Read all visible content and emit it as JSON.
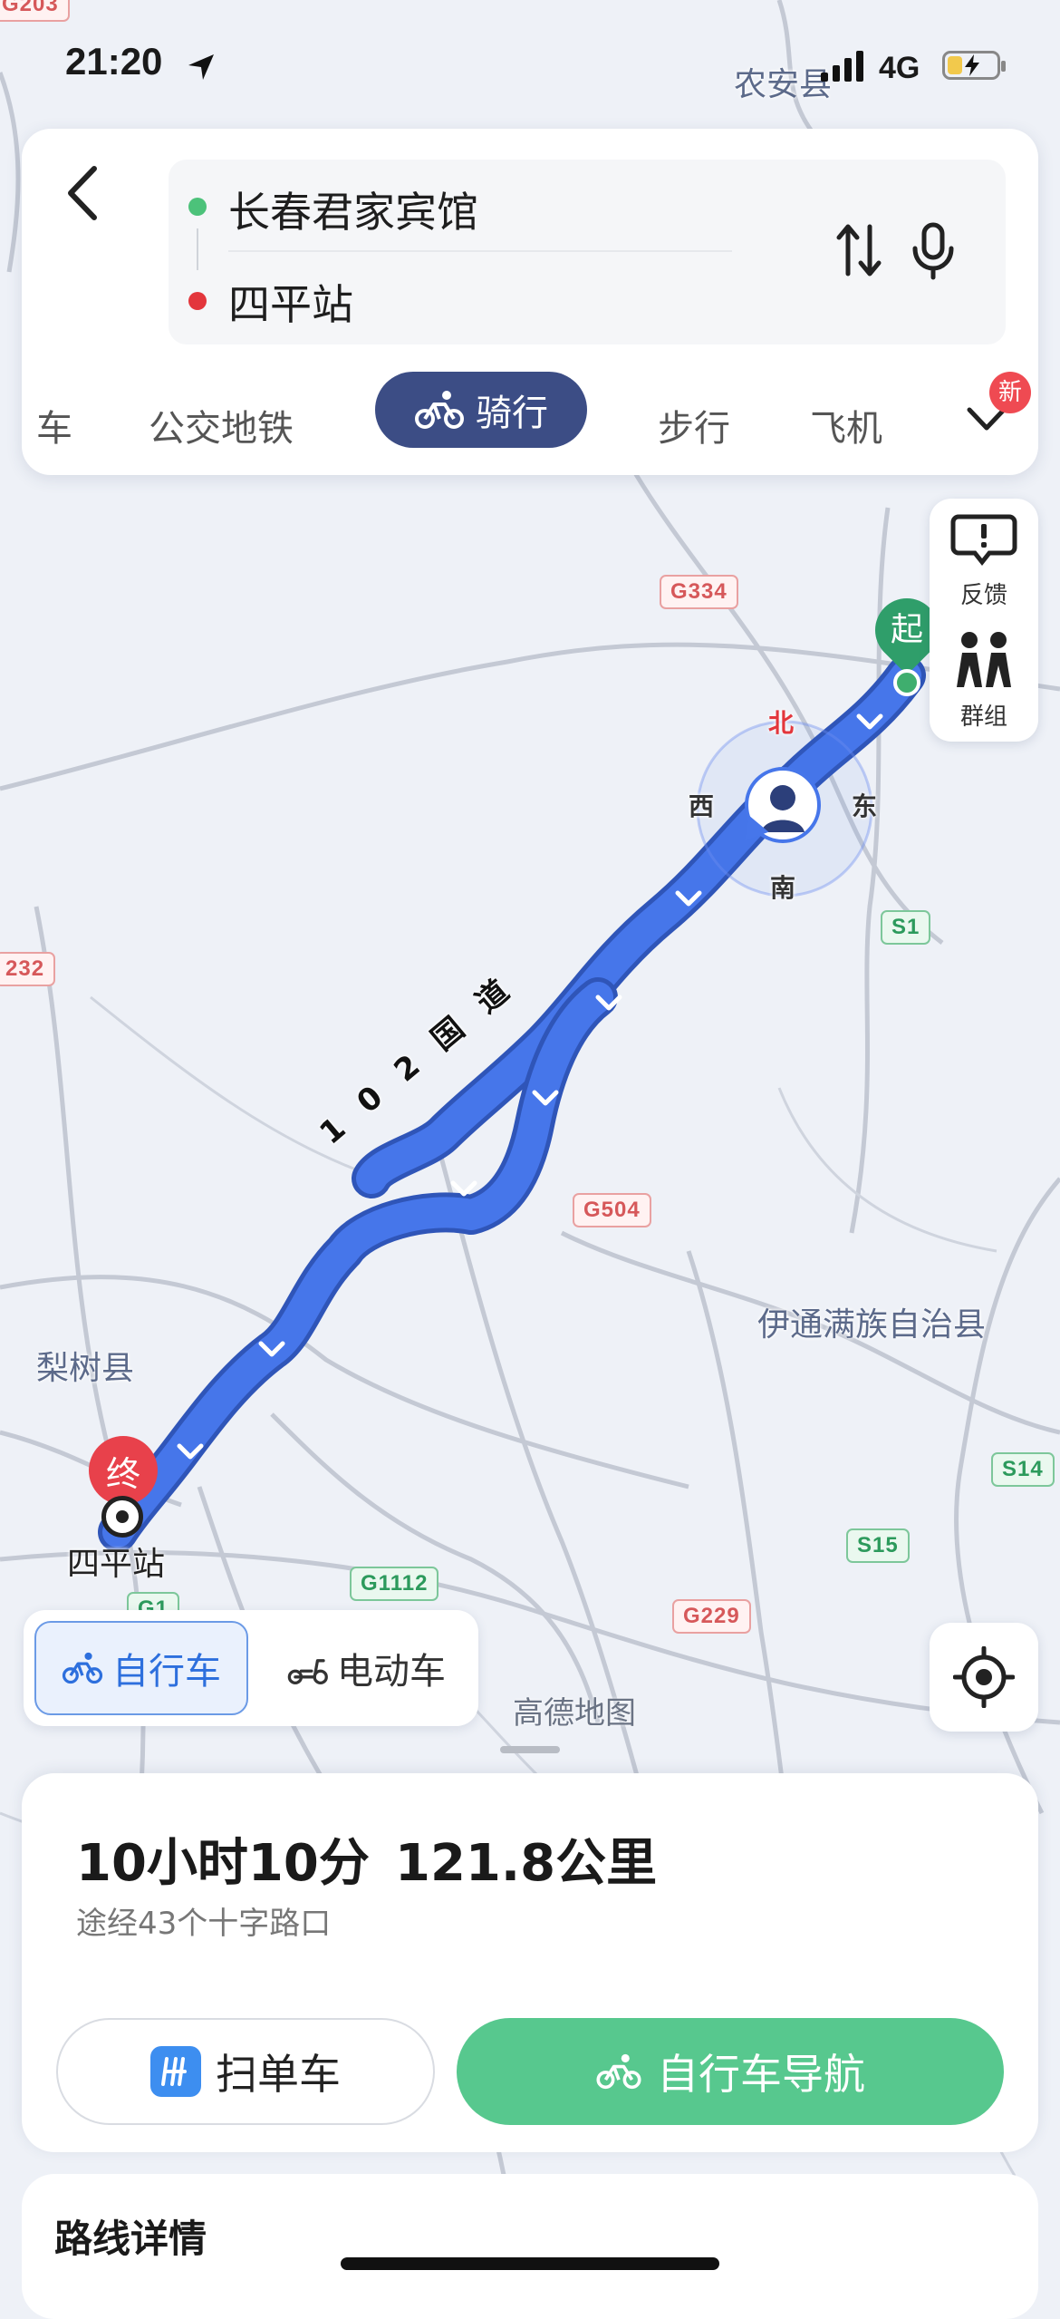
{
  "status_bar": {
    "time": "21:20",
    "network": "4G"
  },
  "search": {
    "origin": "长春君家宾馆",
    "destination": "四平站",
    "modes": [
      "车",
      "公交地铁",
      "骑行",
      "步行",
      "飞机"
    ],
    "active_mode": "骑行",
    "new_badge": "新"
  },
  "side_panel": {
    "feedback": "反馈",
    "group": "群组"
  },
  "map": {
    "road_shields": [
      "G203",
      "G334",
      "232",
      "S1",
      "G504",
      "S14",
      "S15",
      "G1112",
      "G229",
      "G1"
    ],
    "place_labels": {
      "nongan": "农安县",
      "lishu": "梨树县",
      "yitong": "伊通满族自治县",
      "siping_station": "四平站"
    },
    "route_name": [
      "1",
      "0",
      "2",
      "国",
      "道"
    ],
    "compass": {
      "north": "北",
      "south": "南",
      "east": "东",
      "west": "西"
    },
    "start_marker": "起",
    "end_marker": "终",
    "watermark": "高德地图"
  },
  "vehicle_toggle": {
    "bicycle": "自行车",
    "ebike": "电动车"
  },
  "summary": {
    "duration": "10小时10分",
    "distance": "121.8公里",
    "via": "途经43个十字路口",
    "scan_bike_button": "扫单车",
    "nav_button": "自行车导航"
  },
  "route_details": {
    "title": "路线详情"
  },
  "colors": {
    "route": "#3f6fe3",
    "nav_green": "#57c88e",
    "active_tab": "#3c4d85",
    "end_red": "#e8414b",
    "start_green": "#2f9e6a"
  }
}
